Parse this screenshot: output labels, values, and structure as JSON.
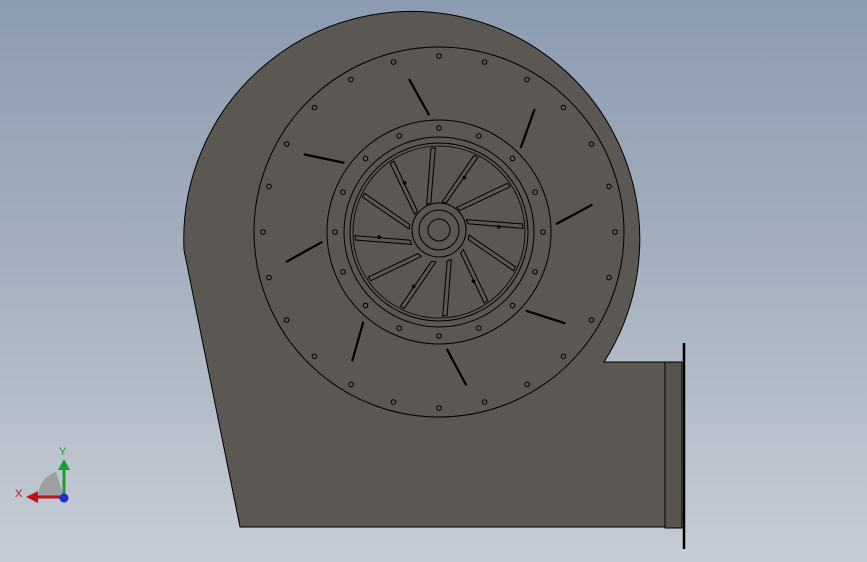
{
  "viewport": {
    "background_top": "#8c9cb1",
    "background_bottom": "#c6cdd6"
  },
  "model": {
    "part": "centrifugal-fan-assembly",
    "view": "front",
    "body_color": "#5b5752",
    "edge_color": "#000000"
  },
  "triad": {
    "x_label": "X",
    "y_label": "Y",
    "x_color": "#c0141c",
    "y_color": "#17a02a",
    "z_color": "#1d2fd1"
  }
}
